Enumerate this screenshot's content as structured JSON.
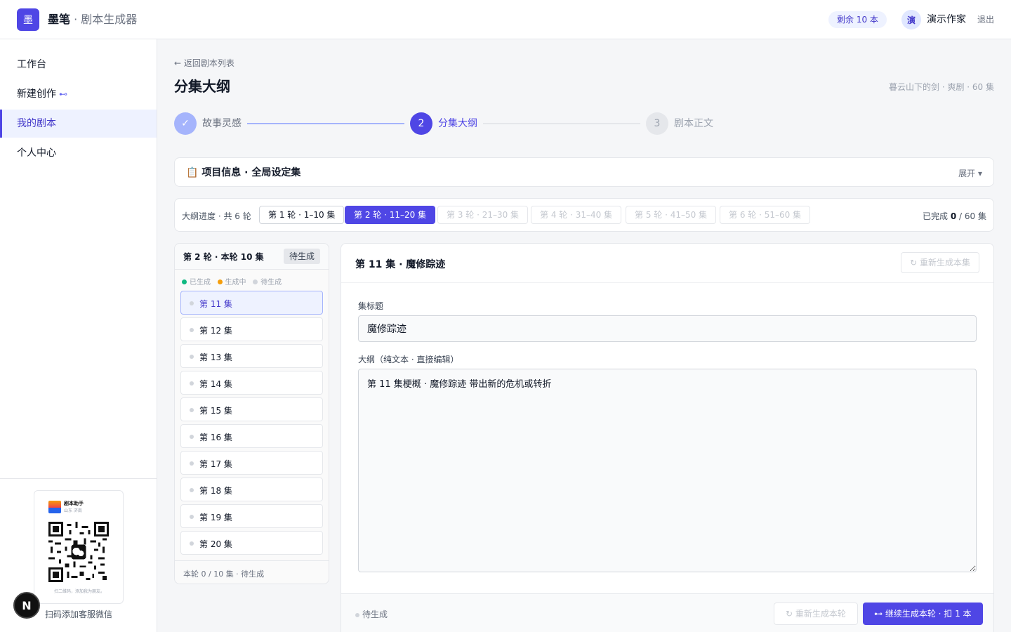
{
  "header": {
    "logo_char": "墨",
    "brand_name": "墨笔",
    "brand_sep": " · ",
    "brand_sub": "剧本生成器",
    "quota": "剩余 10 本",
    "avatar_char": "演",
    "user_name": "演示作家",
    "logout": "退出"
  },
  "sidebar": {
    "items": [
      {
        "label": "工作台"
      },
      {
        "label": "新建创作",
        "icon": "arrow-icon",
        "icon_char": "⊷"
      },
      {
        "label": "我的剧本",
        "active": true
      },
      {
        "label": "个人中心"
      }
    ],
    "qr_caption": "扫码添加客服微信",
    "accent_color": "#4f46e5"
  },
  "page": {
    "back_link": "← 返回剧本列表",
    "title": "分集大纲",
    "meta": "暮云山下的剑 · 爽剧 · 60 集"
  },
  "stepper": {
    "steps": [
      {
        "num": "✓",
        "label": "故事灵感",
        "state": "done"
      },
      {
        "num": "2",
        "label": "分集大纲",
        "state": "active"
      },
      {
        "num": "3",
        "label": "剧本正文",
        "state": "todo"
      }
    ]
  },
  "project_info": {
    "icon": "clipboard-icon",
    "icon_char": "📋",
    "title": "项目信息 · 全局设定集",
    "expand": "展开 ▾"
  },
  "progress": {
    "label": "大纲进度 · 共 6 轮",
    "rounds": [
      {
        "label": "第 1 轮 · 1–10 集",
        "state": "normal"
      },
      {
        "label": "第 2 轮 · 11–20 集",
        "state": "active"
      },
      {
        "label": "第 3 轮 · 21–30 集",
        "state": "disabled"
      },
      {
        "label": "第 4 轮 · 31–40 集",
        "state": "disabled"
      },
      {
        "label": "第 5 轮 · 41–50 集",
        "state": "disabled"
      },
      {
        "label": "第 6 轮 · 51–60 集",
        "state": "disabled"
      }
    ],
    "done_prefix": "已完成 ",
    "done_count": "0",
    "done_suffix": " / 60 集"
  },
  "episode_panel": {
    "title": "第 2 轮 · 本轮 10 集",
    "status": "待生成",
    "legend": [
      {
        "label": "已生成",
        "color": "#10b981"
      },
      {
        "label": "生成中",
        "color": "#f59e0b"
      },
      {
        "label": "待生成",
        "color": "#d1d5db"
      }
    ],
    "episodes": [
      "第 11 集",
      "第 12 集",
      "第 13 集",
      "第 14 集",
      "第 15 集",
      "第 16 集",
      "第 17 集",
      "第 18 集",
      "第 19 集",
      "第 20 集"
    ],
    "selected_index": 0,
    "footer": "本轮 0 / 10 集 · 待生成"
  },
  "editor": {
    "heading": "第 11 集 · 魔修踪迹",
    "regen_episode": "↻ 重新生成本集",
    "title_label": "集标题",
    "title_value": "魔修踪迹",
    "outline_label": "大纲（纯文本 · 直接编辑）",
    "outline_value": "第 11 集梗概 · 魔修踪迹 带出新的危机或转折",
    "status": "待生成",
    "regen_round": "↻ 重新生成本轮",
    "continue": "⊷ 继续生成本轮 · 扣 1 本"
  }
}
